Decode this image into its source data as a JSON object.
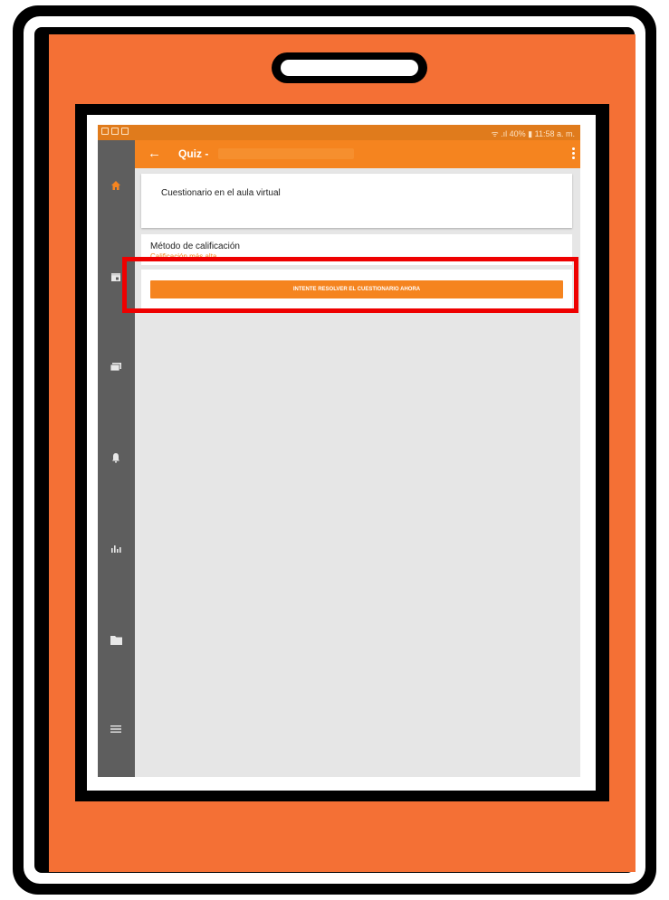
{
  "status_bar": {
    "right_text": "ᯤ .ıl 40% ▮ 11:58 a. m."
  },
  "app_bar": {
    "title": "Quiz -",
    "back_glyph": "←"
  },
  "quiz": {
    "description": "Cuestionario en el aula virtual",
    "grading_label": "Método de calificación",
    "grading_value": "Calificación más alta",
    "attempt_button": "INTENTE RESOLVER EL CUESTIONARIO AHORA"
  },
  "sidebar": {
    "items": [
      {
        "icon": "home-icon",
        "active": true
      },
      {
        "icon": "calendar-icon",
        "active": false
      },
      {
        "icon": "courses-icon",
        "active": false
      },
      {
        "icon": "notifications-icon",
        "active": false
      },
      {
        "icon": "grades-icon",
        "active": false
      },
      {
        "icon": "files-icon",
        "active": false
      },
      {
        "icon": "menu-icon",
        "active": false
      }
    ]
  },
  "colors": {
    "accent": "#f5841f",
    "status_bar": "#e07b1c",
    "sidebar": "#5e5e5e",
    "frame_orange": "#f47035",
    "highlight": "#ee0000"
  }
}
